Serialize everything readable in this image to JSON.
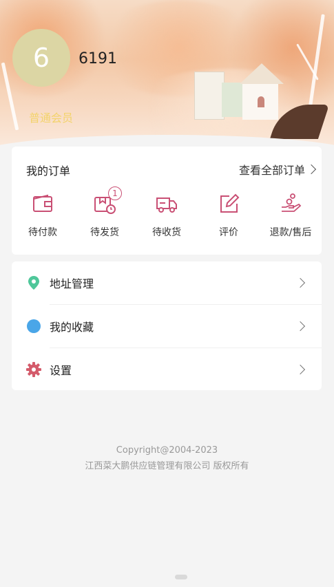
{
  "profile": {
    "avatar_initial": "6",
    "username": "6191",
    "member_label": "普通会员"
  },
  "orders": {
    "title": "我的订单",
    "view_all": "查看全部订单",
    "items": [
      {
        "label": "待付款",
        "icon": "wallet-icon"
      },
      {
        "label": "待发货",
        "icon": "package-clock-icon",
        "badge": "1"
      },
      {
        "label": "待收货",
        "icon": "truck-icon"
      },
      {
        "label": "评价",
        "icon": "edit-icon"
      },
      {
        "label": "退款/售后",
        "icon": "refund-hand-icon"
      }
    ]
  },
  "menu": {
    "items": [
      {
        "label": "地址管理",
        "icon": "location-pin-icon",
        "color": "#4fc79a"
      },
      {
        "label": "我的收藏",
        "icon": "favorite-circle-icon",
        "color": "#4aa6e8"
      },
      {
        "label": "设置",
        "icon": "gear-icon",
        "color": "#d45b6b"
      }
    ]
  },
  "footer": {
    "copyright": "Copyright@2004-2023",
    "company": "江西菜大鹏供应链管理有限公司 版权所有"
  },
  "colors": {
    "accent": "#c94f74",
    "member": "#f3d36b",
    "avatar_bg": "#dcd6a4"
  }
}
